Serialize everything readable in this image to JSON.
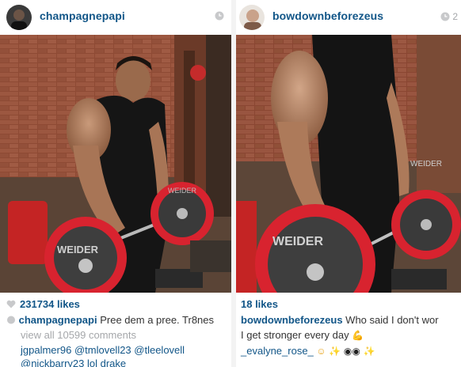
{
  "left_post": {
    "username": "champagnepapi",
    "time": "",
    "likes": "231734 likes",
    "caption_user": "champagnepapi",
    "caption_text": "Pree dem a pree. Tr8nes",
    "view_all": "view all 10599 comments",
    "comment_user": "jgpalmer96",
    "comment_text": " @tmlovell23 @tleelovell",
    "comment_text_2": "@nickbarry23 lol drake",
    "plate_text": "WEIDER",
    "plate_text_2": "WEIDER"
  },
  "right_post": {
    "username": "bowdownbeforezeus",
    "time": "2",
    "likes": "18 likes",
    "caption_user": "bowdownbeforezeus",
    "caption_text": " Who said I don't wor",
    "caption_line2": "I get stronger every day",
    "comment_user": "_evalyne_rose_",
    "plate_text": "WEIDER",
    "plate_text_2": "WEIDER"
  },
  "colors": {
    "username_blue": "#125688",
    "meta_gray": "#a5a7aa",
    "plate_red": "#d8232f"
  },
  "icons": [
    "clock-icon",
    "heart-icon",
    "flexed-biceps-emoji",
    "smiling-face-emoji",
    "sparkles-emoji",
    "eyes-emoji"
  ]
}
